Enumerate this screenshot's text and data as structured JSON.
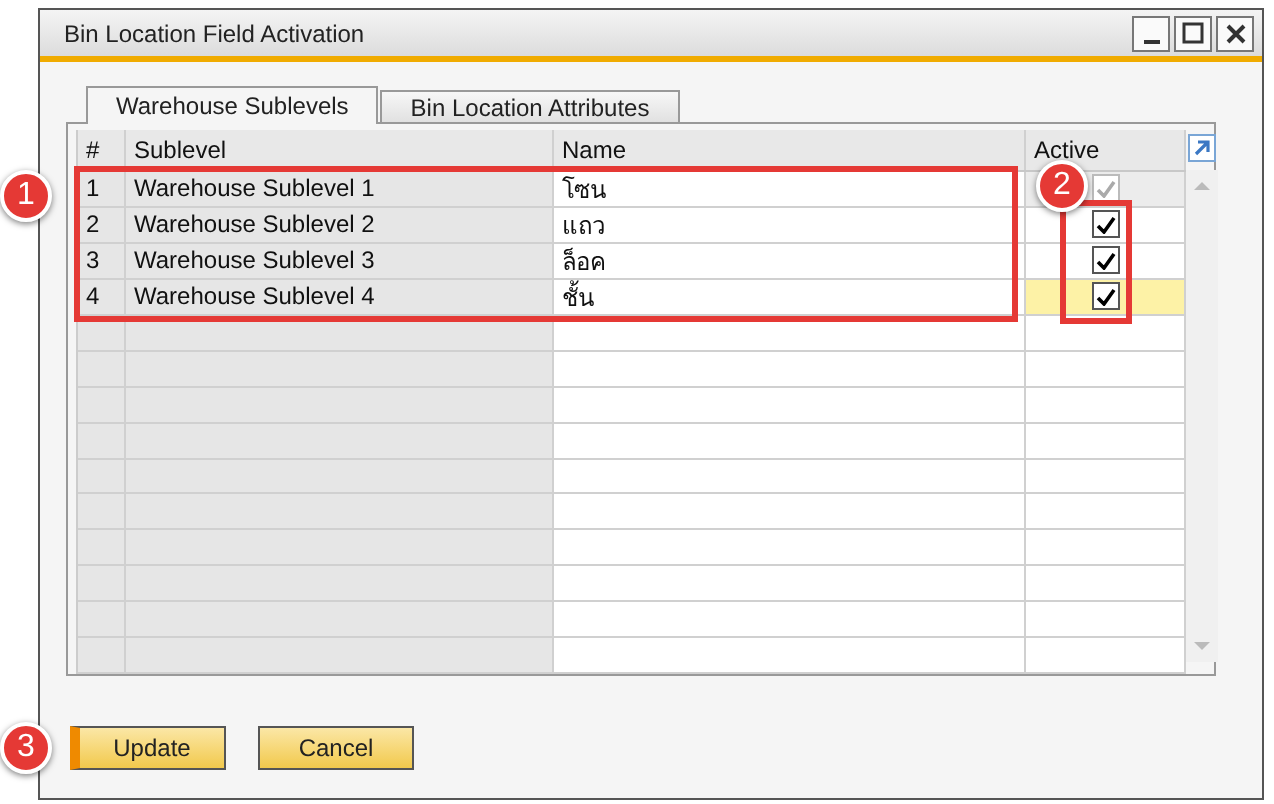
{
  "window": {
    "title": "Bin Location Field Activation"
  },
  "tabs": [
    {
      "label": "Warehouse Sublevels",
      "selected": true
    },
    {
      "label": "Bin Location Attributes",
      "selected": false
    }
  ],
  "table": {
    "columns": [
      "#",
      "Sublevel",
      "Name",
      "Active"
    ],
    "rows": [
      {
        "number": "1",
        "sublevel": "Warehouse Sublevel 1",
        "name": "โซน",
        "active": true,
        "disabled": true,
        "current": false
      },
      {
        "number": "2",
        "sublevel": "Warehouse Sublevel 2",
        "name": "แถว",
        "active": true,
        "disabled": false,
        "current": false
      },
      {
        "number": "3",
        "sublevel": "Warehouse Sublevel 3",
        "name": "ล็อค",
        "active": true,
        "disabled": false,
        "current": false
      },
      {
        "number": "4",
        "sublevel": "Warehouse Sublevel 4",
        "name": "ชั้น",
        "active": true,
        "disabled": false,
        "current": true
      }
    ]
  },
  "buttons": [
    {
      "label": "Update",
      "default": true
    },
    {
      "label": "Cancel",
      "default": false
    }
  ],
  "callouts": [
    {
      "label": "1"
    },
    {
      "label": "2"
    },
    {
      "label": "3"
    }
  ]
}
